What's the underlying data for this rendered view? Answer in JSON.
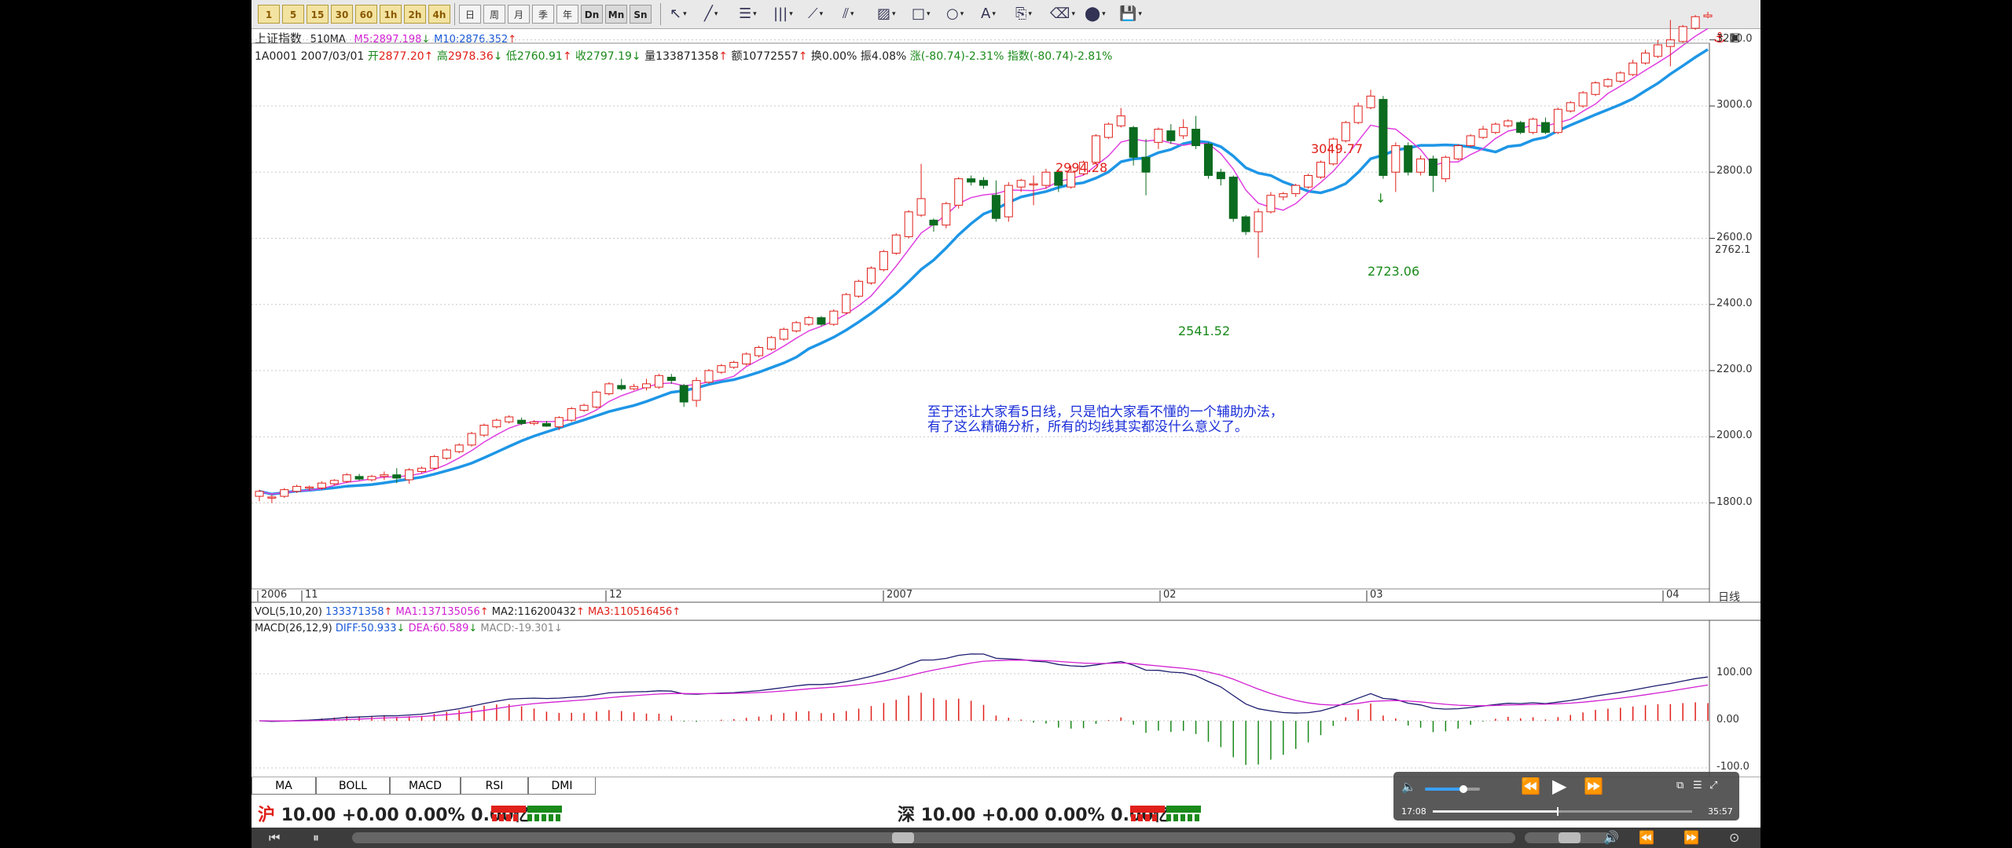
{
  "toolbar": {
    "period_buttons": [
      "1",
      "5",
      "15",
      "30",
      "60",
      "1h",
      "2h",
      "4h"
    ],
    "view_buttons": [
      "日",
      "周",
      "月",
      "季",
      "年",
      "Dn",
      "Mn",
      "Sn"
    ]
  },
  "header": {
    "title": "上证指数",
    "param": "510MA",
    "m5_label": "M5:",
    "m5_value": "2897.198",
    "m10_label": "M10:",
    "m10_value": "2876.352"
  },
  "quote": {
    "code": "1A0001",
    "date": "2007/03/01",
    "open_label": "开",
    "open": "2877.20",
    "high_label": "高",
    "high": "2978.36",
    "low_label": "低",
    "low": "2760.91",
    "close_label": "收",
    "close": "2797.19",
    "vol_label": "量",
    "vol": "133871358",
    "amt_label": "额",
    "amt": "10772557",
    "turnover": "换0.00%",
    "amplitude": "振4.08%",
    "change": "涨(-80.74)-2.31%",
    "index_change": "指数(-80.74)-2.81%"
  },
  "annotations": {
    "peak1": "2994.28",
    "peak2": "3049.77",
    "trough1": "2541.52",
    "trough2": "2723.06",
    "note_line1": "至于还让大家看5日线，只是怕大家看不懂的一个辅助办法，",
    "note_line2": "有了这么精确分析，所有的均线其实都没什么意义了。"
  },
  "price_axis": {
    "ticks": [
      "3200.0",
      "3000.0",
      "2800.0",
      "2600.0",
      "2400.0",
      "2200.0",
      "2000.0",
      "1800.0"
    ],
    "current": "2762.1",
    "top_icon": "anchor-icon"
  },
  "date_axis": {
    "labels": [
      "2006",
      "11",
      "12",
      "2007",
      "02",
      "03",
      "04"
    ],
    "period_label": "日线"
  },
  "volume": {
    "label": "VOL(5,10,20)",
    "value": "133371358",
    "ma1": "MA1:137135056",
    "ma2": "MA2:116200432",
    "ma3": "MA3:110516456"
  },
  "macd": {
    "label": "MACD(26,12,9)",
    "diff": "DIFF:50.933",
    "dea": "DEA:60.589",
    "macd": "MACD:-19.301",
    "ticks": [
      "100.00",
      "0.00",
      "-100.0"
    ]
  },
  "tabs": [
    "MA",
    "BOLL",
    "MACD",
    "RSI",
    "DMI"
  ],
  "bottom": {
    "sh_prefix": "沪",
    "sh_text": "10.00 +0.00 0.00% 0.00亿",
    "sz_prefix": "深",
    "sz_text": "10.00 +0.00 0.00% 0.00亿"
  },
  "player": {
    "elapsed": "17:08",
    "total": "35:57",
    "volume_level": 0.7,
    "progress": 0.48
  },
  "chart_data": {
    "type": "candlestick",
    "title": "上证指数",
    "x_labels": [
      "2006",
      "11",
      "12",
      "2007",
      "02",
      "03",
      "04"
    ],
    "ylim": [
      1750,
      3300
    ],
    "y_ticks": [
      1800,
      2000,
      2200,
      2400,
      2600,
      2800,
      3000,
      3200
    ],
    "candles": [
      [
        1820,
        1835,
        1805,
        1840
      ],
      [
        1815,
        1818,
        1800,
        1825
      ],
      [
        1820,
        1840,
        1815,
        1845
      ],
      [
        1835,
        1850,
        1830,
        1855
      ],
      [
        1845,
        1848,
        1838,
        1852
      ],
      [
        1845,
        1860,
        1840,
        1865
      ],
      [
        1858,
        1868,
        1852,
        1872
      ],
      [
        1865,
        1885,
        1860,
        1890
      ],
      [
        1880,
        1872,
        1868,
        1888
      ],
      [
        1870,
        1880,
        1865,
        1885
      ],
      [
        1880,
        1885,
        1870,
        1895
      ],
      [
        1885,
        1875,
        1860,
        1905
      ],
      [
        1870,
        1900,
        1858,
        1905
      ],
      [
        1895,
        1905,
        1890,
        1910
      ],
      [
        1905,
        1940,
        1900,
        1945
      ],
      [
        1935,
        1960,
        1930,
        1965
      ],
      [
        1955,
        1975,
        1950,
        1980
      ],
      [
        1975,
        2010,
        1970,
        2015
      ],
      [
        2005,
        2035,
        2000,
        2040
      ],
      [
        2030,
        2050,
        2025,
        2055
      ],
      [
        2045,
        2060,
        2040,
        2065
      ],
      [
        2050,
        2040,
        2035,
        2058
      ],
      [
        2040,
        2045,
        2035,
        2050
      ],
      [
        2040,
        2032,
        2030,
        2048
      ],
      [
        2030,
        2058,
        2020,
        2062
      ],
      [
        2050,
        2085,
        2045,
        2090
      ],
      [
        2080,
        2095,
        2075,
        2100
      ],
      [
        2090,
        2135,
        2085,
        2140
      ],
      [
        2130,
        2160,
        2125,
        2165
      ],
      [
        2155,
        2145,
        2140,
        2175
      ],
      [
        2145,
        2152,
        2140,
        2160
      ],
      [
        2148,
        2160,
        2140,
        2175
      ],
      [
        2150,
        2185,
        2145,
        2190
      ],
      [
        2180,
        2170,
        2160,
        2190
      ],
      [
        2155,
        2105,
        2090,
        2160
      ],
      [
        2110,
        2170,
        2090,
        2180
      ],
      [
        2165,
        2200,
        2160,
        2205
      ],
      [
        2195,
        2215,
        2190,
        2220
      ],
      [
        2210,
        2225,
        2205,
        2230
      ],
      [
        2220,
        2250,
        2215,
        2255
      ],
      [
        2245,
        2270,
        2240,
        2275
      ],
      [
        2265,
        2300,
        2260,
        2305
      ],
      [
        2295,
        2325,
        2290,
        2330
      ],
      [
        2320,
        2345,
        2315,
        2350
      ],
      [
        2340,
        2360,
        2335,
        2365
      ],
      [
        2360,
        2340,
        2335,
        2365
      ],
      [
        2340,
        2380,
        2335,
        2385
      ],
      [
        2375,
        2430,
        2370,
        2435
      ],
      [
        2425,
        2470,
        2420,
        2475
      ],
      [
        2465,
        2510,
        2460,
        2515
      ],
      [
        2505,
        2560,
        2500,
        2565
      ],
      [
        2555,
        2610,
        2550,
        2615
      ],
      [
        2605,
        2680,
        2600,
        2685
      ],
      [
        2670,
        2720,
        2665,
        2825
      ],
      [
        2655,
        2640,
        2620,
        2660
      ],
      [
        2640,
        2705,
        2630,
        2710
      ],
      [
        2700,
        2780,
        2690,
        2785
      ],
      [
        2780,
        2770,
        2760,
        2790
      ],
      [
        2775,
        2760,
        2750,
        2785
      ],
      [
        2730,
        2660,
        2650,
        2775
      ],
      [
        2665,
        2760,
        2650,
        2770
      ],
      [
        2755,
        2775,
        2740,
        2780
      ],
      [
        2765,
        2765,
        2700,
        2790
      ],
      [
        2760,
        2800,
        2750,
        2810
      ],
      [
        2800,
        2760,
        2740,
        2810
      ],
      [
        2755,
        2800,
        2750,
        2820
      ],
      [
        2795,
        2830,
        2790,
        2835
      ],
      [
        2830,
        2910,
        2825,
        2915
      ],
      [
        2905,
        2945,
        2900,
        2950
      ],
      [
        2940,
        2970,
        2935,
        2994
      ],
      [
        2935,
        2845,
        2820,
        2940
      ],
      [
        2845,
        2800,
        2730,
        2900
      ],
      [
        2890,
        2930,
        2870,
        2935
      ],
      [
        2925,
        2895,
        2885,
        2945
      ],
      [
        2910,
        2935,
        2900,
        2960
      ],
      [
        2930,
        2880,
        2870,
        2970
      ],
      [
        2885,
        2790,
        2780,
        2890
      ],
      [
        2800,
        2780,
        2760,
        2810
      ],
      [
        2785,
        2660,
        2650,
        2790
      ],
      [
        2665,
        2620,
        2610,
        2670
      ],
      [
        2620,
        2680,
        2541,
        2690
      ],
      [
        2680,
        2730,
        2675,
        2740
      ],
      [
        2725,
        2735,
        2715,
        2740
      ],
      [
        2735,
        2760,
        2725,
        2765
      ],
      [
        2755,
        2790,
        2750,
        2795
      ],
      [
        2785,
        2830,
        2780,
        2835
      ],
      [
        2825,
        2900,
        2820,
        2905
      ],
      [
        2895,
        2950,
        2890,
        2955
      ],
      [
        2950,
        3000,
        2945,
        3010
      ],
      [
        2995,
        3030,
        2990,
        3049
      ],
      [
        3020,
        2790,
        2780,
        3030
      ],
      [
        2800,
        2880,
        2740,
        2890
      ],
      [
        2880,
        2800,
        2790,
        2890
      ],
      [
        2800,
        2840,
        2790,
        2850
      ],
      [
        2840,
        2790,
        2740,
        2850
      ],
      [
        2780,
        2845,
        2770,
        2850
      ],
      [
        2840,
        2880,
        2835,
        2885
      ],
      [
        2880,
        2910,
        2875,
        2915
      ],
      [
        2905,
        2930,
        2900,
        2940
      ],
      [
        2920,
        2945,
        2915,
        2950
      ],
      [
        2940,
        2955,
        2935,
        2960
      ],
      [
        2950,
        2920,
        2915,
        2955
      ],
      [
        2920,
        2960,
        2915,
        2965
      ],
      [
        2950,
        2920,
        2915,
        2965
      ],
      [
        2920,
        2990,
        2915,
        2995
      ],
      [
        2985,
        3010,
        2980,
        3015
      ],
      [
        3000,
        3040,
        2995,
        3045
      ],
      [
        3035,
        3070,
        3030,
        3075
      ],
      [
        3060,
        3080,
        3055,
        3085
      ],
      [
        3075,
        3100,
        3070,
        3105
      ],
      [
        3095,
        3130,
        3090,
        3140
      ],
      [
        3130,
        3160,
        3125,
        3170
      ],
      [
        3150,
        3185,
        3145,
        3200
      ],
      [
        3180,
        3200,
        3120,
        3260
      ],
      [
        3195,
        3240,
        3190,
        3245
      ],
      [
        3235,
        3270,
        3230,
        3275
      ],
      [
        3270,
        3275,
        3265,
        3285
      ]
    ]
  }
}
